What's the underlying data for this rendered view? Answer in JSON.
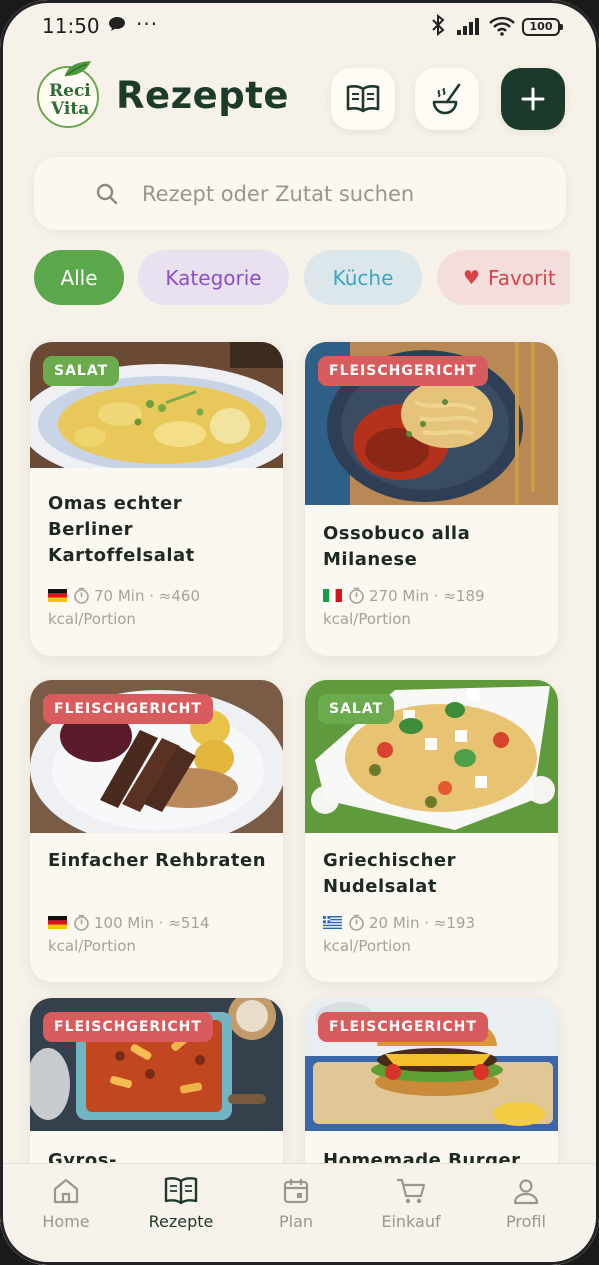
{
  "status_bar": {
    "time": "11:50",
    "battery": "100"
  },
  "header": {
    "logo_line1": "Reci",
    "logo_line2": "Vita",
    "title": "Rezepte",
    "buttons": [
      {
        "icon": "book-icon"
      },
      {
        "icon": "ladle-icon"
      },
      {
        "icon": "plus-icon"
      }
    ]
  },
  "search": {
    "placeholder": "Rezept oder Zutat suchen",
    "value": ""
  },
  "filters": [
    {
      "label": "Alle",
      "active": true
    },
    {
      "label": "Kategorie"
    },
    {
      "label": "Küche"
    },
    {
      "label": "Favorit",
      "icon": "heart-icon"
    }
  ],
  "recipes": [
    {
      "category": "SALAT",
      "name": "Omas echter Berliner Kartoffelsalat",
      "flag": "DE",
      "minutes": "70 Min",
      "kcal": "≈460",
      "unit": "kcal/Portion"
    },
    {
      "category": "FLEISCHGERICHT",
      "name": "Ossobuco alla Milanese",
      "flag": "IT",
      "minutes": "270 Min",
      "kcal": "≈189",
      "unit": "kcal/Portion"
    },
    {
      "category": "FLEISCHGERICHT",
      "name": "Einfacher Rehbraten",
      "flag": "DE",
      "minutes": "100 Min",
      "kcal": "≈514",
      "unit": "kcal/Portion"
    },
    {
      "category": "SALAT",
      "name": "Griechischer Nudelsalat",
      "flag": "GR",
      "minutes": "20 Min",
      "kcal": "≈193",
      "unit": "kcal/Portion"
    },
    {
      "category": "FLEISCHGERICHT",
      "name": "Gyros-",
      "flag": "",
      "minutes": "",
      "kcal": "",
      "unit": ""
    },
    {
      "category": "FLEISCHGERICHT",
      "name": "Homemade Burger",
      "flag": "",
      "minutes": "",
      "kcal": "",
      "unit": ""
    }
  ],
  "bottom_nav": [
    {
      "label": "Home",
      "icon": "home-icon"
    },
    {
      "label": "Rezepte",
      "icon": "book-icon",
      "active": true
    },
    {
      "label": "Plan",
      "icon": "calendar-icon"
    },
    {
      "label": "Einkauf",
      "icon": "cart-icon"
    },
    {
      "label": "Profil",
      "icon": "profile-icon"
    }
  ],
  "colors": {
    "accent_dark": "#1b3a2b",
    "green": "#5aa84b",
    "red_badge": "#d85b5e",
    "background": "#f6f2ea"
  }
}
